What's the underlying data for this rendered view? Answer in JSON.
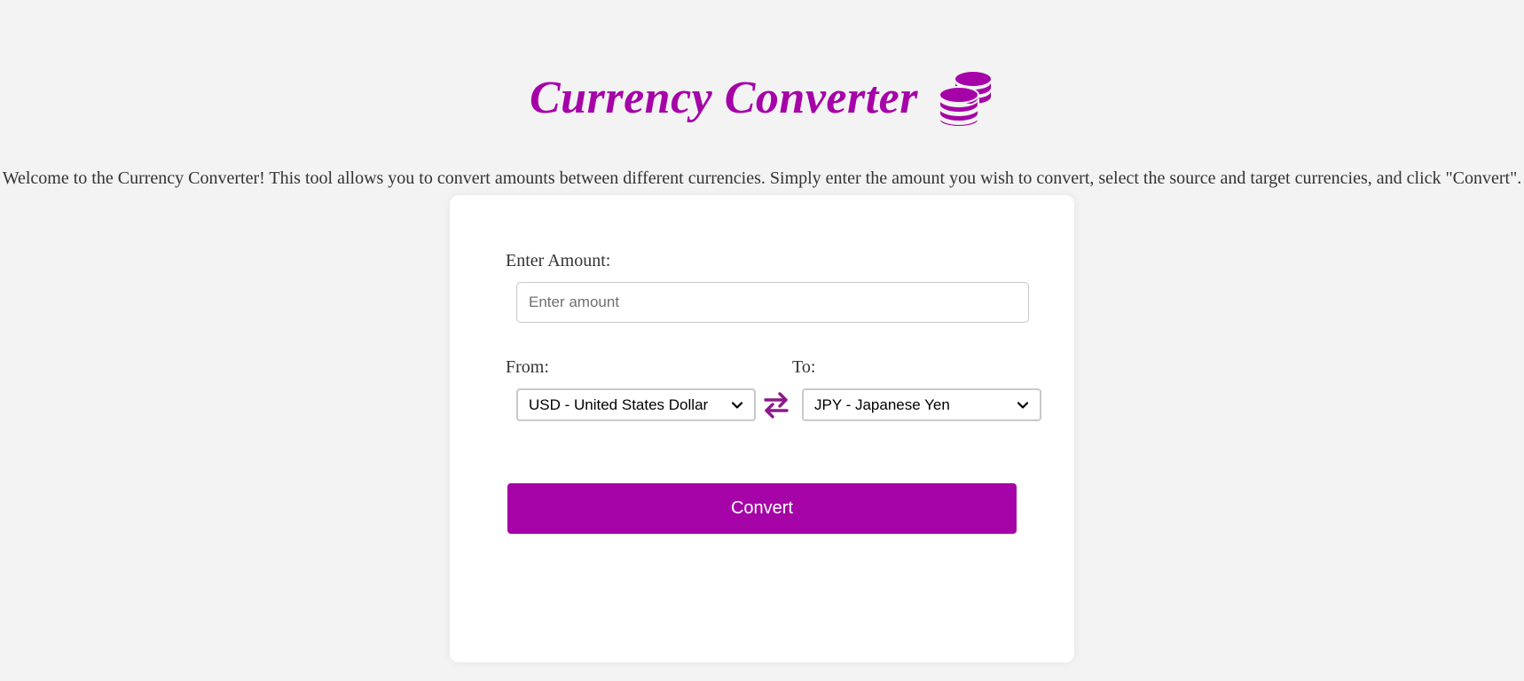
{
  "header": {
    "title": "Currency Converter",
    "icon": "coins-icon",
    "title_color": "#a503a8"
  },
  "intro": {
    "text": "Welcome to the Currency Converter! This tool allows you to convert amounts between different currencies. Simply enter the amount you wish to convert, select the source and target currencies, and click \"Convert\"."
  },
  "form": {
    "amount_label": "Enter Amount:",
    "amount_value": "",
    "amount_placeholder": "Enter amount",
    "from_label": "From:",
    "from_selected": "USD - United States Dollar",
    "to_label": "To:",
    "to_selected": "JPY - Japanese Yen",
    "swap_icon": "swap-arrows-icon",
    "convert_label": "Convert",
    "accent_color": "#a503a8"
  }
}
